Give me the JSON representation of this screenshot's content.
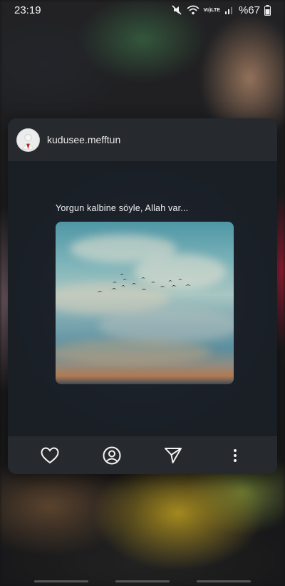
{
  "status_bar": {
    "time": "23:19",
    "volte_top": "Vo)",
    "volte_bottom": "LTE",
    "battery": "%67"
  },
  "post": {
    "username": "kudusee.mefftun",
    "caption": "Yorgun kalbine söyle, Allah var...",
    "actions": [
      "heart-icon",
      "profile-icon",
      "share-icon",
      "more-icon"
    ]
  }
}
